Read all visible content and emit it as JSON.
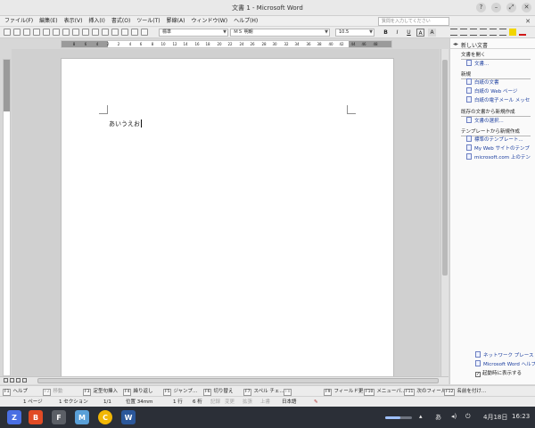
{
  "window": {
    "title": "文書 1 - Microsoft Word",
    "buttons": [
      "?",
      "–",
      "⤢",
      "✕"
    ]
  },
  "menubar": {
    "items": [
      "ファイル(F)",
      "編集(E)",
      "表示(V)",
      "挿入(I)",
      "書式(O)",
      "ツール(T)",
      "罫線(A)",
      "ウィンドウ(W)",
      "ヘルプ(H)"
    ],
    "ask_placeholder": "質問を入力してください",
    "close": "✕"
  },
  "toolbar": {
    "style": "標準",
    "font": "ＭＳ 明朝",
    "size": "10.5",
    "format_buttons": [
      "B",
      "I",
      "U",
      "A",
      "A"
    ]
  },
  "ruler": {
    "numbers": [
      "8",
      "6",
      "4",
      "2",
      "2",
      "4",
      "6",
      "8",
      "10",
      "12",
      "14",
      "16",
      "18",
      "20",
      "22",
      "24",
      "26",
      "28",
      "30",
      "32",
      "34",
      "36",
      "38",
      "40",
      "42",
      "44",
      "46",
      "48"
    ]
  },
  "document": {
    "text": "あいうえお"
  },
  "taskpane": {
    "title": "新しい文書",
    "sections": [
      {
        "heading": "文書を開く",
        "links": [
          "文書..."
        ]
      },
      {
        "heading": "新規",
        "links": [
          "白紙の文書",
          "白紙の Web ページ",
          "白紙の電子メール メッセ"
        ]
      },
      {
        "heading": "既存の文書から新規作成",
        "links": [
          "文書の選択..."
        ]
      },
      {
        "heading": "テンプレートから新規作成",
        "links": [
          "標準のテンプレート...",
          "My Web サイトのテンプ",
          "microsoft.com 上のテン"
        ]
      }
    ],
    "footer_links": [
      "ネットワーク プレース",
      "Microsoft Word ヘルプ"
    ],
    "startup_check": "起動時に表示する",
    "startup_checked": true
  },
  "fkeys": [
    {
      "key": "F1",
      "label": "ヘルプ",
      "enabled": true
    },
    {
      "key": "F2",
      "label": "移動",
      "enabled": false
    },
    {
      "key": "F3",
      "label": "定型句挿入",
      "enabled": true
    },
    {
      "key": "F4",
      "label": "繰り返し",
      "enabled": true
    },
    {
      "key": "F5",
      "label": "ジャンプ...",
      "enabled": true
    },
    {
      "key": "F6",
      "label": "切り替え",
      "enabled": true
    },
    {
      "key": "F7",
      "label": "スペル チェ...",
      "enabled": true
    },
    {
      "key": "F8",
      "label": "",
      "enabled": false
    },
    {
      "key": "F9",
      "label": "フィールド更",
      "enabled": true
    },
    {
      "key": "F10",
      "label": "メニューバ...",
      "enabled": true
    },
    {
      "key": "F11",
      "label": "次のフィール",
      "enabled": true
    },
    {
      "key": "F12",
      "label": "名前を付け...",
      "enabled": true
    }
  ],
  "status": {
    "page": "1 ページ",
    "section": "1 セクション",
    "pages": "1/1",
    "position": "位置 34mm",
    "line": "1 行",
    "column": "6 桁",
    "rec": "記録",
    "trk": "変更",
    "ext": "拡張",
    "ovr": "上書",
    "lang": "日本語"
  },
  "taskbar": {
    "apps": [
      "Z",
      "B",
      "F",
      "M",
      "C",
      "W"
    ],
    "app_colors": [
      "#4a6fe3",
      "#e14b25",
      "#5b5f66",
      "#5aa0d8",
      "#f2b705",
      "#2b579a"
    ],
    "volume_level": 0.55,
    "ime": "あ",
    "date": "4月18日",
    "time": "16:23"
  }
}
